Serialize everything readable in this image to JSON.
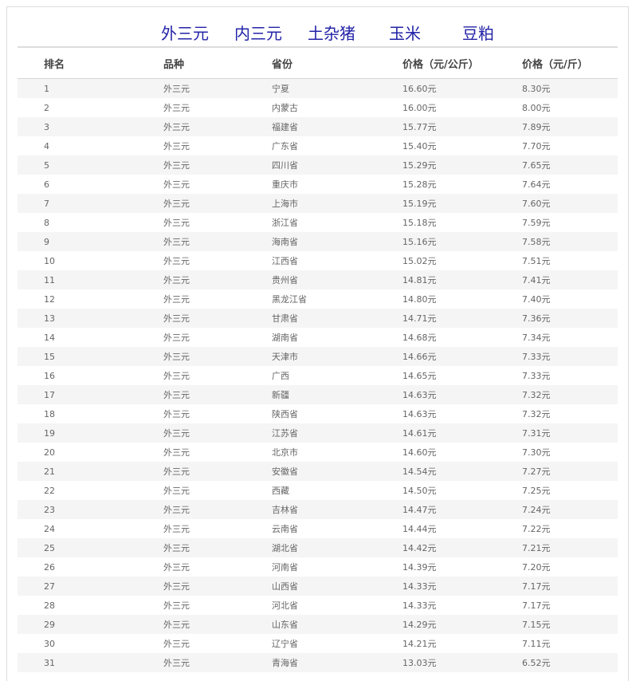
{
  "tabs": [
    "外三元",
    "内三元",
    "土杂猪",
    "玉米",
    "豆粕"
  ],
  "active_tab": 0,
  "table": {
    "headers": [
      "排名",
      "品种",
      "省份",
      "价格（元/公斤）",
      "价格（元/斤）"
    ],
    "rows": [
      [
        "1",
        "外三元",
        "宁夏",
        "16.60元",
        "8.30元"
      ],
      [
        "2",
        "外三元",
        "内蒙古",
        "16.00元",
        "8.00元"
      ],
      [
        "3",
        "外三元",
        "福建省",
        "15.77元",
        "7.89元"
      ],
      [
        "4",
        "外三元",
        "广东省",
        "15.40元",
        "7.70元"
      ],
      [
        "5",
        "外三元",
        "四川省",
        "15.29元",
        "7.65元"
      ],
      [
        "6",
        "外三元",
        "重庆市",
        "15.28元",
        "7.64元"
      ],
      [
        "7",
        "外三元",
        "上海市",
        "15.19元",
        "7.60元"
      ],
      [
        "8",
        "外三元",
        "浙江省",
        "15.18元",
        "7.59元"
      ],
      [
        "9",
        "外三元",
        "海南省",
        "15.16元",
        "7.58元"
      ],
      [
        "10",
        "外三元",
        "江西省",
        "15.02元",
        "7.51元"
      ],
      [
        "11",
        "外三元",
        "贵州省",
        "14.81元",
        "7.41元"
      ],
      [
        "12",
        "外三元",
        "黑龙江省",
        "14.80元",
        "7.40元"
      ],
      [
        "13",
        "外三元",
        "甘肃省",
        "14.71元",
        "7.36元"
      ],
      [
        "14",
        "外三元",
        "湖南省",
        "14.68元",
        "7.34元"
      ],
      [
        "15",
        "外三元",
        "天津市",
        "14.66元",
        "7.33元"
      ],
      [
        "16",
        "外三元",
        "广西",
        "14.65元",
        "7.33元"
      ],
      [
        "17",
        "外三元",
        "新疆",
        "14.63元",
        "7.32元"
      ],
      [
        "18",
        "外三元",
        "陕西省",
        "14.63元",
        "7.32元"
      ],
      [
        "19",
        "外三元",
        "江苏省",
        "14.61元",
        "7.31元"
      ],
      [
        "20",
        "外三元",
        "北京市",
        "14.60元",
        "7.30元"
      ],
      [
        "21",
        "外三元",
        "安徽省",
        "14.54元",
        "7.27元"
      ],
      [
        "22",
        "外三元",
        "西藏",
        "14.50元",
        "7.25元"
      ],
      [
        "23",
        "外三元",
        "吉林省",
        "14.47元",
        "7.24元"
      ],
      [
        "24",
        "外三元",
        "云南省",
        "14.44元",
        "7.22元"
      ],
      [
        "25",
        "外三元",
        "湖北省",
        "14.42元",
        "7.21元"
      ],
      [
        "26",
        "外三元",
        "河南省",
        "14.39元",
        "7.20元"
      ],
      [
        "27",
        "外三元",
        "山西省",
        "14.33元",
        "7.17元"
      ],
      [
        "28",
        "外三元",
        "河北省",
        "14.33元",
        "7.17元"
      ],
      [
        "29",
        "外三元",
        "山东省",
        "14.29元",
        "7.15元"
      ],
      [
        "30",
        "外三元",
        "辽宁省",
        "14.21元",
        "7.11元"
      ],
      [
        "31",
        "外三元",
        "青海省",
        "13.03元",
        "6.52元"
      ]
    ]
  },
  "colors": {
    "tab_text": "#2323a8",
    "tab_active_underline": "#1e73c8",
    "row_stripe": "#f5f5f5",
    "cell_text": "#666666",
    "header_text": "#444444"
  }
}
